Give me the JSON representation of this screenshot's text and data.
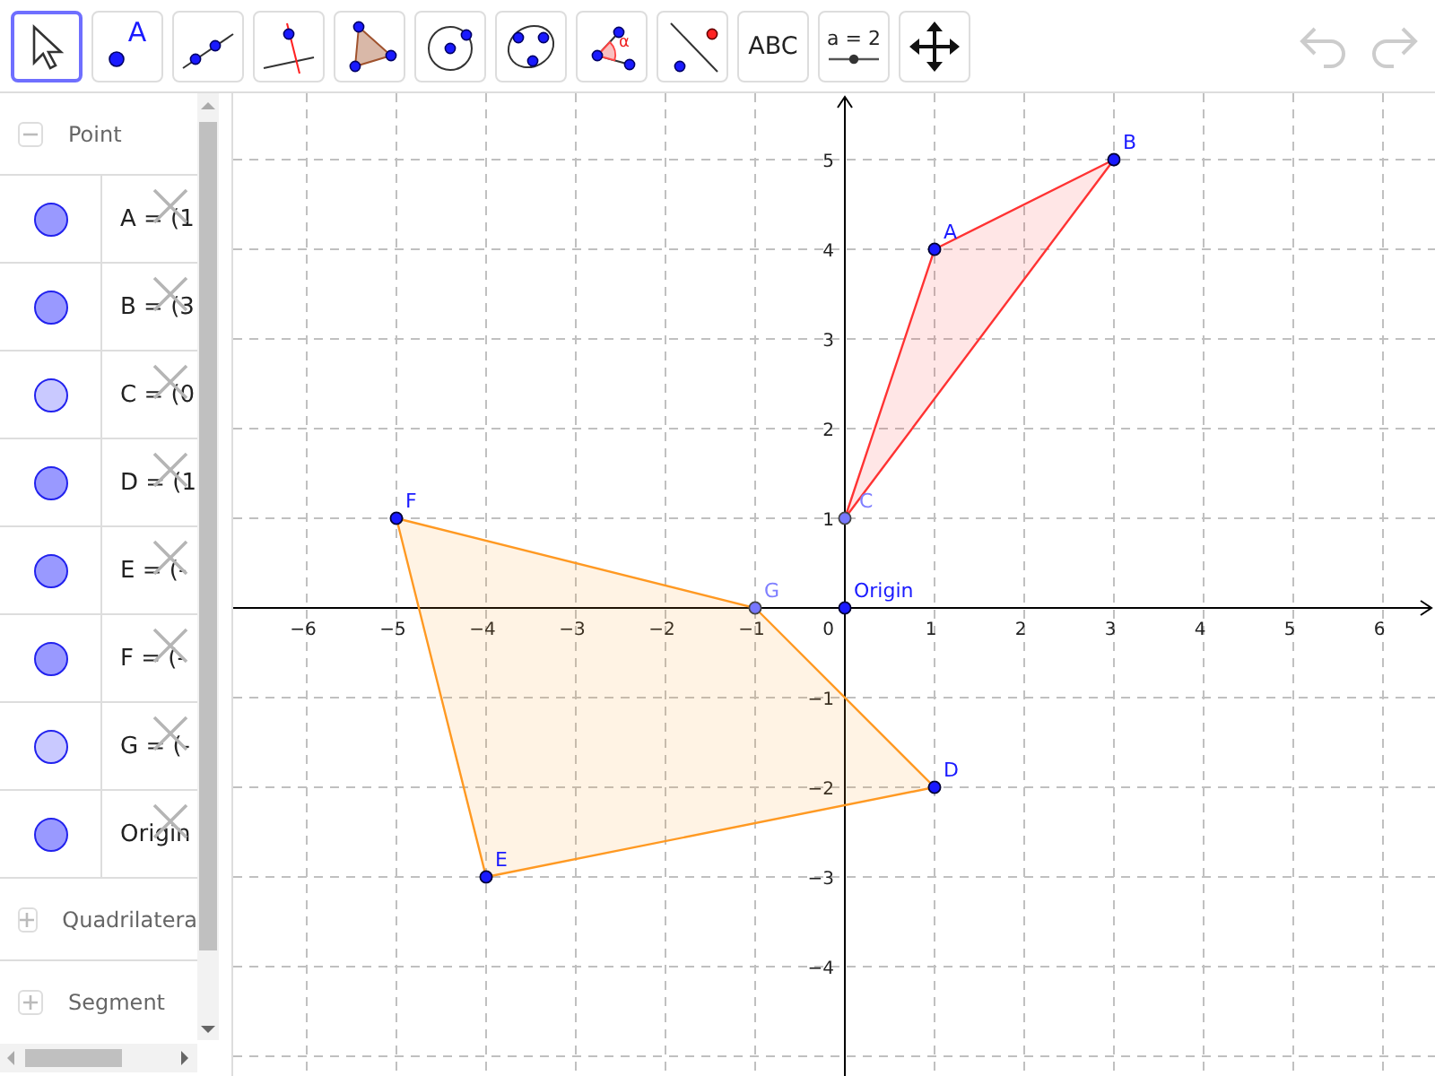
{
  "toolbar": {
    "tools": [
      {
        "kind": "move",
        "selected": true
      },
      {
        "kind": "point",
        "selected": false,
        "label": "A"
      },
      {
        "kind": "line",
        "selected": false
      },
      {
        "kind": "perpendicular",
        "selected": false
      },
      {
        "kind": "polygon",
        "selected": false
      },
      {
        "kind": "circle",
        "selected": false
      },
      {
        "kind": "conic",
        "selected": false
      },
      {
        "kind": "angle",
        "selected": false,
        "label": "α"
      },
      {
        "kind": "reflect",
        "selected": false
      },
      {
        "kind": "text",
        "selected": false,
        "label": "ABC"
      },
      {
        "kind": "slider",
        "selected": false,
        "label": "a = 2"
      },
      {
        "kind": "move-view",
        "selected": false
      }
    ],
    "undo": {
      "disabled": true
    },
    "redo": {
      "disabled": true
    }
  },
  "algebra": {
    "groups": [
      {
        "title": "Point",
        "expanded": true,
        "items": [
          {
            "text": "A = (1",
            "light": false
          },
          {
            "text": "B = (3",
            "light": false
          },
          {
            "text": "C = (0",
            "light": true
          },
          {
            "text": "D = (1",
            "light": false
          },
          {
            "text": "E = (-",
            "light": false
          },
          {
            "text": "F = (-",
            "light": false
          },
          {
            "text": "G = (-",
            "light": true
          },
          {
            "text": "Origin",
            "light": false
          }
        ]
      },
      {
        "title": "Quadrilatera",
        "expanded": false
      },
      {
        "title": "Segment",
        "expanded": false
      }
    ]
  },
  "graphics": {
    "x_ticks": [
      "−6",
      "−5",
      "−4",
      "−3",
      "−2",
      "−1",
      "1",
      "2",
      "3",
      "4",
      "5",
      "6"
    ],
    "y_ticks": [
      "5",
      "4",
      "3",
      "2",
      "1",
      "−1",
      "−2",
      "−3",
      "−4"
    ],
    "origin_label": "0",
    "polygons": [
      {
        "kind": "triangle",
        "color": "#ff3333"
      },
      {
        "kind": "quadrilateral",
        "color": "#ff9922"
      }
    ],
    "points": [
      {
        "label": "A",
        "light": false
      },
      {
        "label": "B",
        "light": false
      },
      {
        "label": "C",
        "light": true
      },
      {
        "label": "D",
        "light": false
      },
      {
        "label": "E",
        "light": false
      },
      {
        "label": "F",
        "light": false
      },
      {
        "label": "G",
        "light": true
      },
      {
        "label": "Origin",
        "light": false
      }
    ]
  }
}
